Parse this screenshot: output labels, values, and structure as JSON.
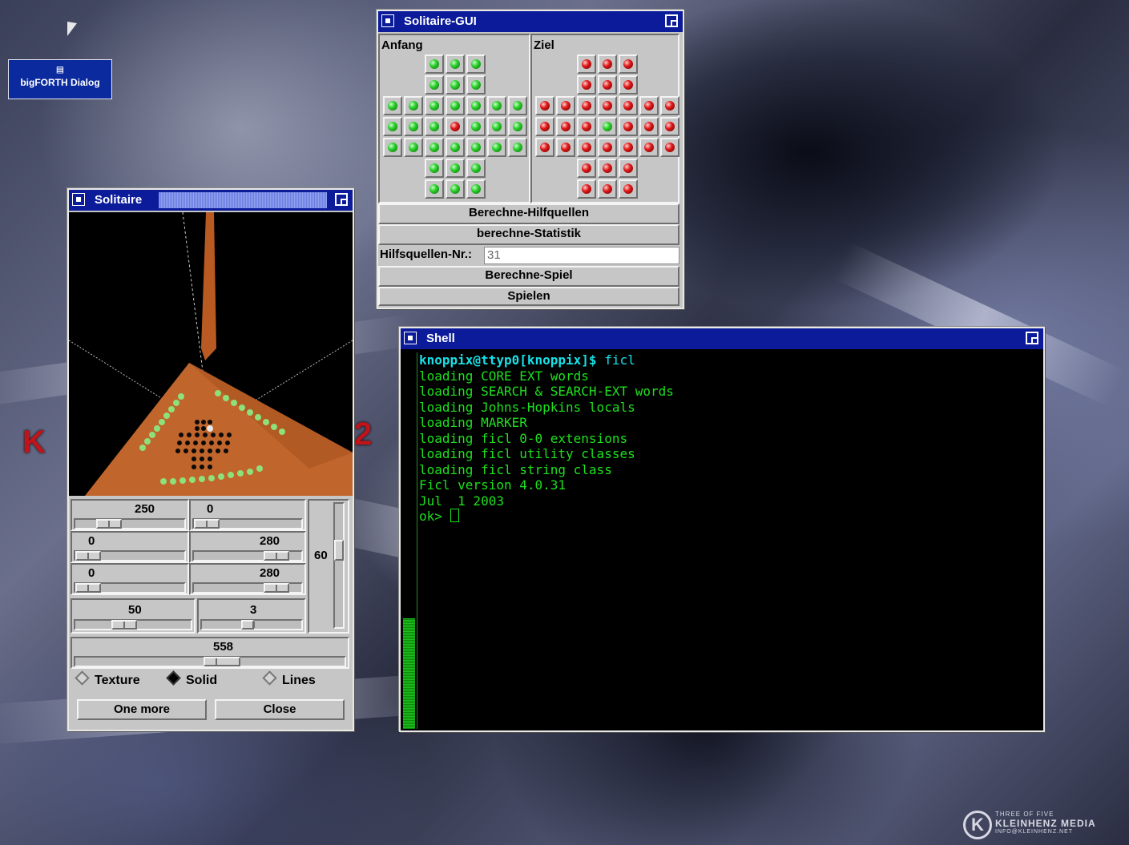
{
  "desktop": {
    "icon": {
      "label": "bigFORTH Dialog"
    },
    "logo_left": "K",
    "logo_right": "2",
    "branding": {
      "line1": "THREE OF FIVE",
      "line2": "KLEINHENZ MEDIA",
      "line3": "INFO@KLEINHENZ.NET"
    }
  },
  "solitaire_gui": {
    "title": "Solitaire-GUI",
    "start_label": "Anfang",
    "goal_label": "Ziel",
    "start_board": [
      "..ggg..",
      "..ggg..",
      "ggggggg",
      "gggrggg",
      "ggggggg",
      "..ggg..",
      "..ggg.."
    ],
    "goal_board": [
      "..rrr..",
      "..rrr..",
      "rrrrrrr",
      "rrrgrrr",
      "rrrrrrr",
      "..rrr..",
      "..rrr.."
    ],
    "peg_colors": {
      "g": "#22cc22",
      "r": "#dd1111"
    },
    "buttons": {
      "compute_helpers": "Berechne-Hilfquellen",
      "compute_stats": "berechne-Statistik",
      "compute_game": "Berechne-Spiel",
      "play": "Spielen"
    },
    "helper_field": {
      "label": "Hilfsquellen-Nr.:",
      "value": "31"
    }
  },
  "solitaire": {
    "title": "Solitaire",
    "sliders": {
      "s1": {
        "value": "250",
        "position": 0.25
      },
      "s2": {
        "value": "0",
        "position": 0.0
      },
      "s3": {
        "value": "0",
        "position": 0.0
      },
      "s4": {
        "value": "280",
        "position": 0.85
      },
      "s5": {
        "value": "0",
        "position": 0.0
      },
      "s6": {
        "value": "280",
        "position": 0.85
      },
      "s7": {
        "value": "50",
        "position": 0.4
      },
      "s8": {
        "value": "3",
        "position": 0.45
      },
      "vertical": {
        "value": "60",
        "position": 0.35
      },
      "wide": {
        "value": "558",
        "position": 0.55
      }
    },
    "render_modes": [
      {
        "label": "Texture",
        "selected": false
      },
      {
        "label": "Solid",
        "selected": true
      },
      {
        "label": "Lines",
        "selected": false
      }
    ],
    "buttons": {
      "one_more": "One more",
      "close": "Close"
    }
  },
  "shell": {
    "title": "Shell",
    "prompt": "knoppix@ttyp0[knoppix]$",
    "command": " ficl",
    "lines": [
      "loading CORE EXT words",
      "loading SEARCH & SEARCH-EXT words",
      "loading Johns-Hopkins locals",
      "loading MARKER",
      "loading ficl 0-0 extensions",
      "loading ficl utility classes",
      "loading ficl string class",
      "Ficl version 4.0.31",
      "Jul  1 2003"
    ],
    "ok_prompt": "ok> "
  }
}
